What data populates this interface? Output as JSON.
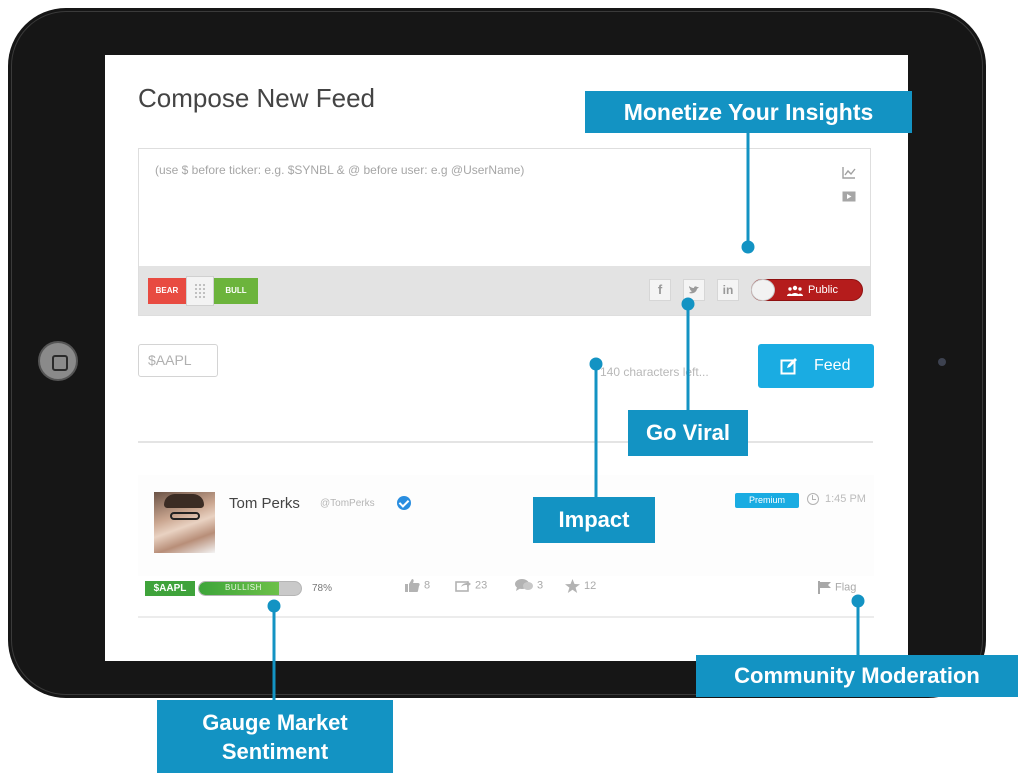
{
  "compose": {
    "title": "Compose New Feed",
    "placeholder": "(use $ before ticker: e.g. $SYNBL & @ before user: e.g @UserName)",
    "bear_label": "BEAR",
    "bull_label": "BULL",
    "social": {
      "facebook": "f",
      "twitter": "t",
      "linkedin": "in"
    },
    "visibility_label": "Public",
    "ticker_value": "$AAPL",
    "chars_left": "140 characters left...",
    "feed_button": "Feed"
  },
  "post": {
    "author": "Tom Perks",
    "handle": "@TomPerks",
    "badge": "Premium",
    "time": "1:45 PM",
    "ticker": "$AAPL",
    "sentiment_label": "BULLISH",
    "sentiment_fraction": 0.78,
    "sentiment_pct": "78%",
    "likes": "8",
    "shares": "23",
    "comments": "3",
    "stars": "12",
    "flag_label": "Flag"
  },
  "callouts": {
    "monetize": "Monetize Your Insights",
    "viral": "Go Viral",
    "impact": "Impact",
    "community": "Community Moderation",
    "gauge_line1": "Gauge Market",
    "gauge_line2": "Sentiment"
  },
  "colors": {
    "accent": "#1aace2",
    "callout": "#1393c3",
    "bear": "#e84b41",
    "bull": "#6cb43c",
    "public": "#b51c1c"
  },
  "icons": {
    "chart": "chart-icon",
    "video": "video-icon",
    "like": "thumbs-up-icon",
    "share": "share-icon",
    "comment": "comment-icon",
    "star": "star-icon",
    "flag": "flag-icon",
    "clock": "clock-icon",
    "verified": "verified-icon"
  }
}
